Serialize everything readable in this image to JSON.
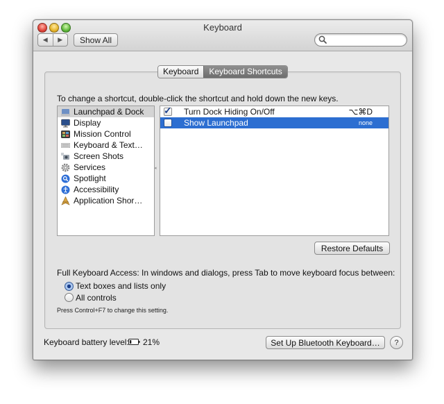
{
  "window": {
    "title": "Keyboard"
  },
  "toolbar": {
    "back": "◀",
    "forward": "▶",
    "show_all_label": "Show All",
    "search_placeholder": "",
    "search_value": ""
  },
  "tabs": [
    {
      "label": "Keyboard",
      "active": false
    },
    {
      "label": "Keyboard Shortcuts",
      "active": true
    }
  ],
  "instruction": "To change a shortcut, double-click the shortcut and hold down the new keys.",
  "categories": [
    {
      "label": "Launchpad & Dock",
      "icon": "launchpad-dock-icon",
      "selected": true
    },
    {
      "label": "Display",
      "icon": "display-icon",
      "selected": false
    },
    {
      "label": "Mission Control",
      "icon": "mission-control-icon",
      "selected": false
    },
    {
      "label": "Keyboard & Text…",
      "icon": "keyboard-icon",
      "selected": false
    },
    {
      "label": "Screen Shots",
      "icon": "screenshot-icon",
      "selected": false
    },
    {
      "label": "Services",
      "icon": "gear-icon",
      "selected": false
    },
    {
      "label": "Spotlight",
      "icon": "spotlight-icon",
      "selected": false
    },
    {
      "label": "Accessibility",
      "icon": "accessibility-icon",
      "selected": false
    },
    {
      "label": "Application Shor…",
      "icon": "app-shortcuts-icon",
      "selected": false
    }
  ],
  "shortcuts": [
    {
      "label": "Turn Dock Hiding On/Off",
      "key": "⌥⌘D",
      "checked": true,
      "selected": false
    },
    {
      "label": "Show Launchpad",
      "key": "none",
      "checked": false,
      "selected": true
    }
  ],
  "restore_defaults_label": "Restore Defaults",
  "full_keyboard_access": {
    "label": "Full Keyboard Access: In windows and dialogs, press Tab to move keyboard focus between:",
    "options": [
      {
        "label": "Text boxes and lists only",
        "selected": true
      },
      {
        "label": "All controls",
        "selected": false
      }
    ],
    "note": "Press Control+F7 to change this setting."
  },
  "battery": {
    "label": "Keyboard battery level:",
    "value": "21%",
    "level": 0.21
  },
  "bluetooth_button_label": "Set Up Bluetooth Keyboard…",
  "help_label": "?",
  "colors": {
    "selection": "#2c6ed1",
    "sidebar_selection": "#d4d4d4"
  }
}
